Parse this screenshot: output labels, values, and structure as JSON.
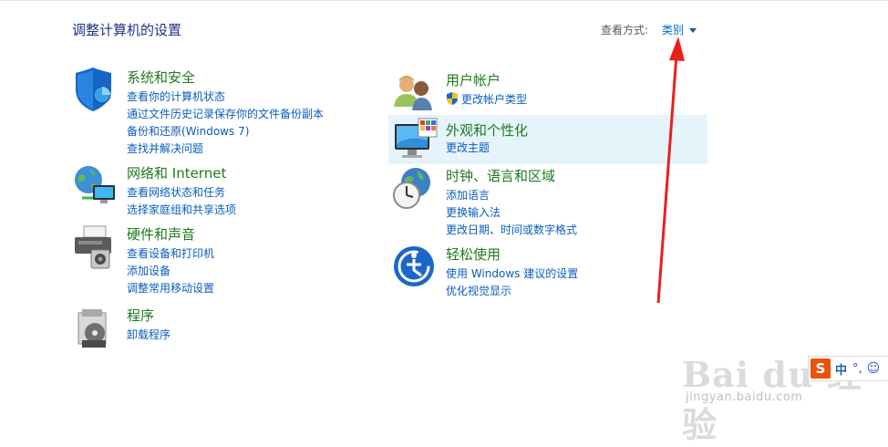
{
  "header": {
    "title": "调整计算机的设置",
    "view_by_label": "查看方式:",
    "view_by_value": "类别"
  },
  "categories": [
    {
      "heading": "系统和安全",
      "icon": "system-security-shield-icon",
      "links": [
        "查看你的计算机状态",
        "通过文件历史记录保存你的文件备份副本",
        "备份和还原(Windows 7)",
        "查找并解决问题"
      ]
    },
    {
      "heading": "网络和 Internet",
      "icon": "network-globe-icon",
      "links": [
        "查看网络状态和任务",
        "选择家庭组和共享选项"
      ]
    },
    {
      "heading": "硬件和声音",
      "icon": "printer-speaker-icon",
      "links": [
        "查看设备和打印机",
        "添加设备",
        "调整常用移动设置"
      ]
    },
    {
      "heading": "程序",
      "icon": "programs-disc-icon",
      "links": [
        "卸载程序"
      ]
    },
    {
      "heading": "用户帐户",
      "icon": "users-icon",
      "links": [
        "更改帐户类型"
      ]
    },
    {
      "heading": "外观和个性化",
      "icon": "monitor-palette-icon",
      "links": [
        "更改主题"
      ]
    },
    {
      "heading": "时钟、语言和区域",
      "icon": "clock-globe-icon",
      "links": [
        "添加语言",
        "更换输入法",
        "更改日期、时间或数字格式"
      ]
    },
    {
      "heading": "轻松使用",
      "icon": "ease-of-access-icon",
      "links": [
        "使用 Windows 建议的设置",
        "优化视觉显示"
      ]
    }
  ],
  "colors": {
    "heading": "#1f7a1f",
    "link": "#0a5cc0",
    "title": "#1e3287",
    "highlight": "#e5f3fb",
    "arrow": "#e8201a"
  },
  "watermark": {
    "brand": "Bai du 经验",
    "url": "jingyan.baidu.com"
  },
  "ime": {
    "logo": "S",
    "mode": "中",
    "punct": "°,",
    "emoji": "☺"
  }
}
